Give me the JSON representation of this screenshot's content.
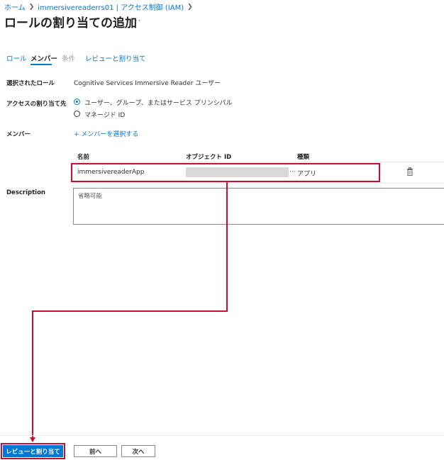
{
  "breadcrumb": {
    "items": [
      "ホーム",
      "immersivereaderrs01 | アクセス制御 (IAM)"
    ]
  },
  "page": {
    "title": "ロールの割り当ての追加",
    "more": "···"
  },
  "tabs": [
    {
      "label": "ロール",
      "state": "normal"
    },
    {
      "label": "メンバー",
      "state": "active"
    },
    {
      "label": "条件",
      "state": "disabled"
    },
    {
      "label": "レビューと割り当て",
      "state": "normal"
    }
  ],
  "form": {
    "selected_role_label": "選択されたロール",
    "selected_role_value": "Cognitive Services Immersive Reader ユーザー",
    "assign_access_label": "アクセスの割り当て先",
    "assign_options": [
      {
        "label": "ユーザー、グループ、またはサービス プリンシパル",
        "checked": true
      },
      {
        "label": "マネージド ID",
        "checked": false
      }
    ],
    "members_label": "メンバー",
    "select_members_link": "+ メンバーを選択する",
    "description_label": "Description",
    "description_placeholder": "省略可能"
  },
  "table": {
    "headers": [
      "名前",
      "オブジェクト ID",
      "種類"
    ],
    "rows": [
      {
        "name": "immersivereaderApp",
        "object_id_suffix": "···",
        "type": "アプリ"
      }
    ]
  },
  "footer": {
    "review_assign_button": "レビューと割り当て",
    "previous_button": "前へ",
    "next_button": "次へ"
  },
  "colors": {
    "accent": "#0078d4",
    "annotation": "#c8102e"
  },
  "icons": {
    "breadcrumb_separator": "chevron-right-icon",
    "row_delete": "trash-icon"
  }
}
